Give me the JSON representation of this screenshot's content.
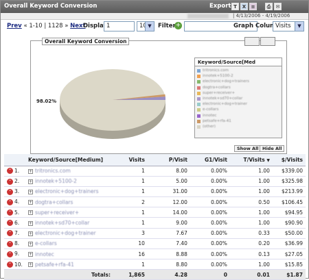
{
  "header": {
    "title": "Overall Keyword Conversion",
    "export_label": "Export",
    "date_range": "| 4/13/2006 - 4/19/2006"
  },
  "controls": {
    "prev": "Prev",
    "range": "« 1-10 | 1128 »",
    "next": "Next",
    "display_label": "Display",
    "display_start": "1",
    "display_count": "10",
    "filter_label": "Filter",
    "graph_column_label": "Graph Column",
    "graph_column_value": "Visits"
  },
  "chart": {
    "title": "Overall Keyword Conversion",
    "pie_label": "98.02%",
    "legend_header": "Keyword/Source[Med",
    "show_all": "Show All",
    "hide_all": "Hide All"
  },
  "legend": [
    {
      "label": "tritronics.com",
      "color": "#7fa7d4"
    },
    {
      "label": "innotek+5100-2",
      "color": "#f0a050"
    },
    {
      "label": "electronic+dog+trainers",
      "color": "#86b86b"
    },
    {
      "label": "dogtra+collars",
      "color": "#d77"
    },
    {
      "label": "super+receiver+",
      "color": "#e8b85a"
    },
    {
      "label": "innotek+sd70+collar",
      "color": "#a9c"
    },
    {
      "label": "electronic+dog+trainer",
      "color": "#9cc"
    },
    {
      "label": "e-collars",
      "color": "#cc8"
    },
    {
      "label": "innotec",
      "color": "#96c"
    },
    {
      "label": "petsafe+rfa-41",
      "color": "#c96"
    },
    {
      "label": "(other)",
      "color": "#d8d4c6"
    }
  ],
  "table": {
    "headers": [
      "Keyword/Source[Medium]",
      "Visits",
      "P/Visit",
      "G1/Visit",
      "T/Visits",
      "$/Visits"
    ],
    "rows": [
      {
        "rank": "1.",
        "keyword": "tritronics.com",
        "visits": "1",
        "pv": "8.00",
        "g1": "0.00%",
        "tv": "1.00",
        "dv": "$339.00"
      },
      {
        "rank": "2.",
        "keyword": "innotek+5100-2",
        "visits": "1",
        "pv": "5.00",
        "g1": "0.00%",
        "tv": "1.00",
        "dv": "$325.98"
      },
      {
        "rank": "3.",
        "keyword": "electronic+dog+trainers",
        "visits": "1",
        "pv": "31.00",
        "g1": "0.00%",
        "tv": "1.00",
        "dv": "$213.99"
      },
      {
        "rank": "4.",
        "keyword": "dogtra+collars",
        "visits": "2",
        "pv": "12.00",
        "g1": "0.00%",
        "tv": "0.50",
        "dv": "$106.45"
      },
      {
        "rank": "5.",
        "keyword": "super+receiver+",
        "visits": "1",
        "pv": "14.00",
        "g1": "0.00%",
        "tv": "1.00",
        "dv": "$94.95"
      },
      {
        "rank": "6.",
        "keyword": "innotek+sd70+collar",
        "visits": "1",
        "pv": "9.00",
        "g1": "0.00%",
        "tv": "1.00",
        "dv": "$90.90"
      },
      {
        "rank": "7.",
        "keyword": "electronic+dog+trainer",
        "visits": "3",
        "pv": "7.67",
        "g1": "0.00%",
        "tv": "0.33",
        "dv": "$50.00"
      },
      {
        "rank": "8.",
        "keyword": "e-collars",
        "visits": "10",
        "pv": "7.40",
        "g1": "0.00%",
        "tv": "0.20",
        "dv": "$36.99"
      },
      {
        "rank": "9.",
        "keyword": "innotec",
        "visits": "16",
        "pv": "8.88",
        "g1": "0.00%",
        "tv": "0.13",
        "dv": "$27.05"
      },
      {
        "rank": "10.",
        "keyword": "petsafe+rfa-41",
        "visits": "1",
        "pv": "8.80",
        "g1": "0.00%",
        "tv": "1.00",
        "dv": "$15.85"
      }
    ],
    "totals": {
      "label": "Totals:",
      "visits": "1,865",
      "pv": "4.28",
      "g1": "0",
      "tv": "0.01",
      "dv": "$1.87"
    }
  }
}
